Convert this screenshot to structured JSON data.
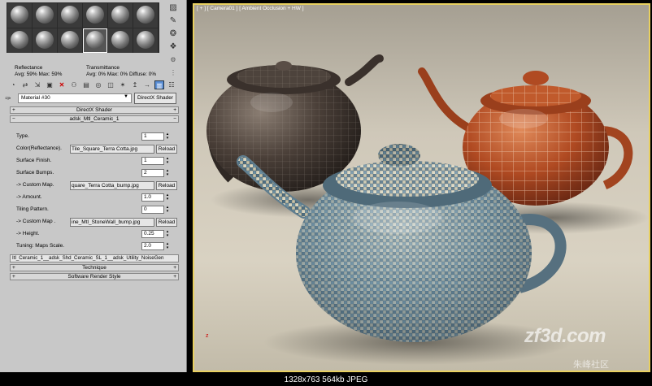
{
  "reflectance": {
    "title": "Reflectance",
    "values": "Avg:  59% Max:  59%"
  },
  "transmittance": {
    "title": "Transmittance",
    "values": "Avg:   0% Max:   0%  Diffuse:   0%"
  },
  "material": {
    "name": "Material #30",
    "type_button": "DirectX Shader"
  },
  "rollouts": {
    "directx_shader": "DirectX Shader",
    "ceramic": "adsk_Mtl_Ceramic_1",
    "technique": "Technique",
    "software_render_style": "Software Render Style"
  },
  "params": {
    "type": {
      "label": "Type.",
      "value": "1"
    },
    "color": {
      "label": "Color(Reflectance).",
      "map": "Tile_Square_Terra Cotta.jpg",
      "button": "Reload"
    },
    "finish": {
      "label": "Surface Finish.",
      "value": "1"
    },
    "bumps": {
      "label": "Surface Bumps.",
      "value": "2"
    },
    "custom_map1": {
      "label": "-> Custom Map.",
      "map": "quare_Terra Cotta_bump.jpg",
      "button": "Reload"
    },
    "amount": {
      "label": "-> Amount.",
      "value": "1.0"
    },
    "tiling": {
      "label": "Tiling Pattern.",
      "value": "0"
    },
    "custom_map2": {
      "label": "-> Custom Map .",
      "map": "ine_Mtl_StoneWall_bump.jpg",
      "button": "Reload"
    },
    "height": {
      "label": "-> Height.",
      "value": "0.25"
    },
    "tuning": {
      "label": "Tuning: Maps Scale.",
      "value": "2.0"
    }
  },
  "shader_chain": "Itl_Ceramic_1__adsk_Shd_Ceramic_SL_1__adsk_Utility_NoiseGen",
  "viewport": {
    "label": "[ + ] [ Camera01 ] [ Ambient Occlusion + HW ]",
    "axis": "z"
  },
  "watermark": {
    "logo": "zf3d.com",
    "sub": "朱峰社区"
  },
  "caption": "1328x763  564kb  JPEG",
  "colors": {
    "panel_bg": "#c8c8c8",
    "viewport_border": "#e8d060",
    "teapot_dark": "#4a3f38",
    "teapot_orange": "#b04a22",
    "teapot_blue": "#6f8fa2"
  }
}
